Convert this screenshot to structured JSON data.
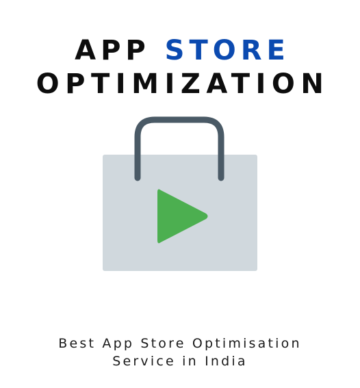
{
  "title": {
    "word_1": "APP",
    "word_2": "STORE",
    "line_2": "OPTIMIZATION"
  },
  "tagline": {
    "line_1": "Best App Store Optimisation",
    "line_2": "Service in India"
  },
  "icon": {
    "name": "shopping-bag-play-icon",
    "bag_color": "#d0d8dd",
    "handle_color": "#4a5a66",
    "play_color": "#4caf50"
  },
  "colors": {
    "accent": "#0b4ab0",
    "text": "#0d0d0d",
    "background": "#ffffff"
  }
}
